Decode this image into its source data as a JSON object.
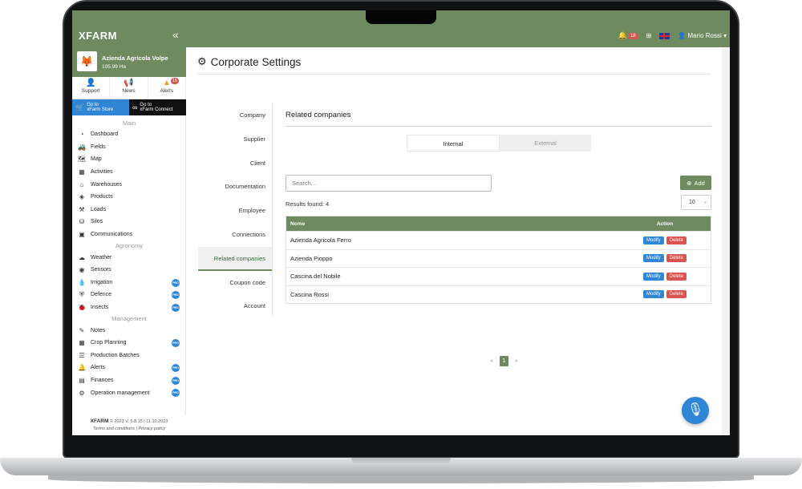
{
  "topbar": {
    "logo": "XFARM",
    "collapse_icon": "«",
    "notification_count": "18",
    "user_name": "Mario Rossi"
  },
  "farm": {
    "name": "Azienda Agricola Volpe",
    "size": "105.99 Ha"
  },
  "quick_links": [
    {
      "label": "Support",
      "icon": "support-icon"
    },
    {
      "label": "News",
      "icon": "megaphone-icon"
    },
    {
      "label": "Alerts",
      "icon": "warning-icon",
      "badge": "15"
    }
  ],
  "goto": {
    "store_line1": "Go to",
    "store_line2": "xFarm Store",
    "connect_line1": "Go to",
    "connect_line2": "xFarm Connect"
  },
  "sidebar": {
    "sections": [
      {
        "title": "Main",
        "items": [
          {
            "label": "Dashboard"
          },
          {
            "label": "Fields"
          },
          {
            "label": "Map"
          },
          {
            "label": "Activities"
          },
          {
            "label": "Warehouses"
          },
          {
            "label": "Products"
          },
          {
            "label": "Loads"
          },
          {
            "label": "Silos"
          },
          {
            "label": "Communications"
          }
        ]
      },
      {
        "title": "Agronomy",
        "items": [
          {
            "label": "Weather"
          },
          {
            "label": "Sensors"
          },
          {
            "label": "Irrigation",
            "pro": "PRO"
          },
          {
            "label": "Defence",
            "pro": "PRO"
          },
          {
            "label": "Insects",
            "pro": "PRO"
          }
        ]
      },
      {
        "title": "Management",
        "items": [
          {
            "label": "Notes"
          },
          {
            "label": "Crop Planning",
            "pro": "PRO"
          },
          {
            "label": "Production Batches"
          },
          {
            "label": "Alerts",
            "pro": "PRO"
          },
          {
            "label": "Finances",
            "pro": "PRO"
          },
          {
            "label": "Operation management",
            "pro": "PRO"
          }
        ]
      }
    ],
    "footer_logo": "XFARM",
    "footer_version": "© 2023 V. 5.8.15 | 11.10.2023",
    "footer_links": "Terms and conditions | Privacy policy"
  },
  "page": {
    "title": "Corporate Settings",
    "subnav": [
      "Company",
      "Supplier",
      "Client",
      "Documentation",
      "Employee",
      "Connections",
      "Related companies",
      "Coupon code",
      "Account"
    ],
    "active_subnav": "Related companies",
    "section_title": "Related companies",
    "toggle": {
      "internal": "Internal",
      "external": "External",
      "selected": "Internal"
    },
    "search_placeholder": "Search...",
    "add_label": "Add",
    "results": "Results found: 4",
    "page_size": "10",
    "table": {
      "headers": [
        "Nome",
        "Action"
      ],
      "rows": [
        {
          "name": "Azienda Agricola Ferro"
        },
        {
          "name": "Azienda Pioppo"
        },
        {
          "name": "Cascina del Nobile"
        },
        {
          "name": "Cascina Rossi"
        }
      ],
      "modify_label": "Modify",
      "delete_label": "Delete"
    },
    "pagination": {
      "prev": "«",
      "current": "1",
      "next": "»"
    }
  },
  "colors": {
    "primary": "#6e8b60",
    "blue": "#2f86d6",
    "red": "#d9534f"
  }
}
